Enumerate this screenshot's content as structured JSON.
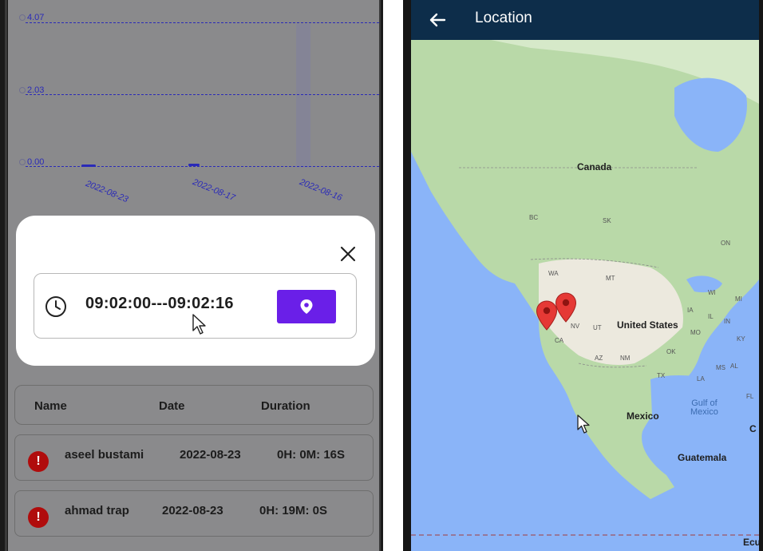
{
  "left_screen": {
    "chart": {
      "y_ticks": [
        "4.07",
        "2.03",
        "0.00"
      ],
      "x_labels": [
        "2022-08-23",
        "2022-08-17",
        "2022-08-16"
      ]
    },
    "modal": {
      "time_range": "09:02:00---09:02:16",
      "close_icon": "close-icon",
      "clock_icon": "clock-icon",
      "location_icon": "location-pin-icon"
    },
    "table": {
      "headers": [
        "Name",
        "Date",
        "Duration"
      ],
      "rows": [
        {
          "name": "aseel bustami",
          "date": "2022-08-23",
          "duration": "0H: 0M: 16S"
        },
        {
          "name": "ahmad trap",
          "date": "2022-08-23",
          "duration": "0H: 19M: 0S"
        }
      ]
    },
    "colors": {
      "accent": "#6a1fe8",
      "warning": "#b00c0c",
      "chart_line": "#2a2ab8"
    }
  },
  "right_screen": {
    "app_bar": {
      "title": "Location",
      "back_icon": "back-arrow-icon"
    },
    "map": {
      "countries": [
        "Canada",
        "United States",
        "Mexico",
        "Guatemala"
      ],
      "water": [
        "Gulf of",
        "Mexico"
      ],
      "states": [
        "BC",
        "SK",
        "ON",
        "WA",
        "MT",
        "NV",
        "UT",
        "CA",
        "AZ",
        "NM",
        "TX",
        "LA",
        "MS",
        "AL",
        "OK",
        "MO",
        "KY",
        "IL",
        "IN",
        "WI",
        "MI",
        "IA",
        "FL",
        "C",
        "Ecu"
      ],
      "pins": 2
    },
    "colors": {
      "app_bar": "#0d2d4a",
      "pin": "#e53935",
      "water": "#8ab4f8",
      "land": "#b9d9a8"
    }
  }
}
